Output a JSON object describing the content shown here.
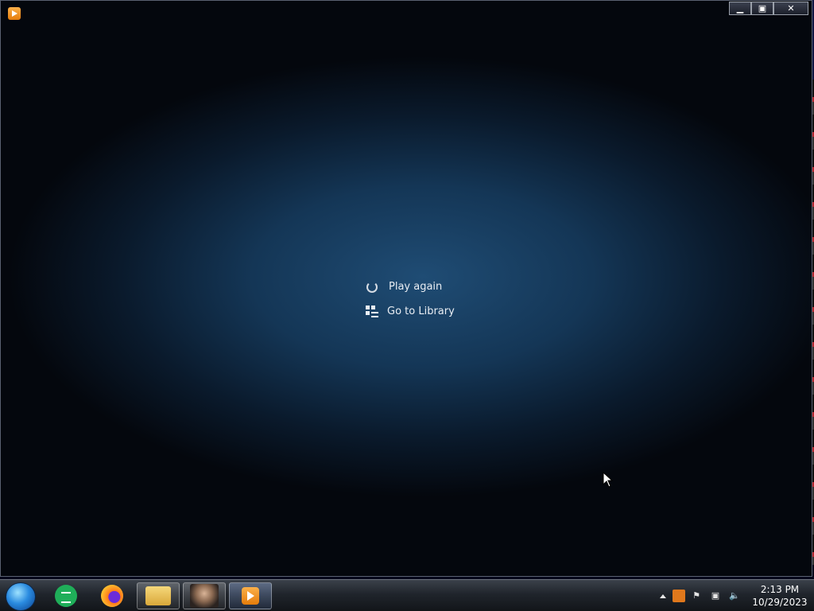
{
  "desktop": {
    "icons": [
      "app-icon",
      "firefox-like-icon",
      "vlc-icon",
      "document-icon",
      "dark-app-icon",
      "orange-icon"
    ]
  },
  "window": {
    "controls": {
      "minimize": "▁",
      "maximize": "▣",
      "close": "✕"
    }
  },
  "end_screen": {
    "play_again": "Play again",
    "go_to_library": "Go to Library"
  },
  "taskbar": {
    "pinned": [
      "sheets",
      "firefox",
      "file-explorer",
      "portrait-app",
      "media-player"
    ],
    "clock": {
      "time": "2:13 PM",
      "date": "10/29/2023"
    }
  },
  "colors": {
    "accent": "#2a8be0",
    "window_bg": "#143656",
    "text": "#e8edf3"
  }
}
